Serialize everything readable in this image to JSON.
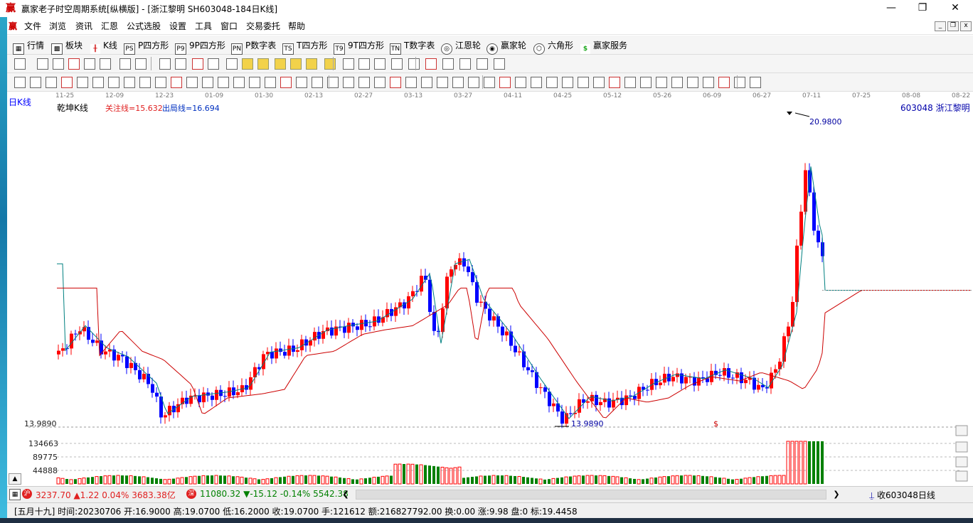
{
  "window": {
    "title": "赢家老子时空周期系统[纵横版] - [浙江黎明  SH603048-184日K线]",
    "logo_char": "赢",
    "minimize": "—",
    "restore": "❐",
    "close": "✕"
  },
  "menu": [
    "文件",
    "浏览",
    "资讯",
    "汇恩",
    "公式选股",
    "设置",
    "工具",
    "窗口",
    "交易委托",
    "帮助"
  ],
  "menu_logo": "赢",
  "toolbar1": [
    {
      "label": "行情",
      "icon": "grid-icon",
      "glyph": "▦"
    },
    {
      "label": "板块",
      "icon": "blocks-icon",
      "glyph": "▩"
    },
    {
      "label": "K线",
      "icon": "kline-icon",
      "glyph": "╫"
    },
    {
      "label": "P四方形",
      "icon": "p-square-icon",
      "glyph": "PS"
    },
    {
      "label": "9P四方形",
      "icon": "9p-square-icon",
      "glyph": "P9"
    },
    {
      "label": "P数字表",
      "icon": "p-table-icon",
      "glyph": "PN"
    },
    {
      "label": "T四方形",
      "icon": "t-square-icon",
      "glyph": "TS"
    },
    {
      "label": "9T四方形",
      "icon": "9t-square-icon",
      "glyph": "T9"
    },
    {
      "label": "T数字表",
      "icon": "t-table-icon",
      "glyph": "TN"
    },
    {
      "label": "江恩轮",
      "icon": "gann-wheel-icon",
      "glyph": "◎"
    },
    {
      "label": "赢家轮",
      "icon": "winner-wheel-icon",
      "glyph": "◉"
    },
    {
      "label": "六角形",
      "icon": "hexagon-icon",
      "glyph": "⬡"
    },
    {
      "label": "赢家服务",
      "icon": "dollar-icon",
      "glyph": "$"
    }
  ],
  "chart": {
    "period_label": "日K线",
    "indicator_name": "乾坤K线",
    "watch_line": "关注线=15.632",
    "exit_line": "出局线=16.694",
    "stock_label": "603048  浙江黎明",
    "high_label": "20.9800",
    "low_label": "13.9890",
    "low_axis_label": "13.9890",
    "dollar_mark": "$",
    "dates": [
      "11-25",
      "12-09",
      "12-23",
      "01-09",
      "01-30",
      "02-13",
      "02-27",
      "03-13",
      "03-27",
      "04-11",
      "04-25",
      "05-12",
      "05-26",
      "06-09",
      "06-27",
      "07-11",
      "07-25",
      "08-08",
      "08-22"
    ],
    "volume_axis": [
      "134663",
      "89775",
      "44888"
    ],
    "colors": {
      "up": "#ff0000",
      "down": "#0000ff",
      "transition": "#800080",
      "ma_short": "#008080",
      "ma_long": "#cc0000",
      "vol_up": "#ff0000",
      "vol_down": "#008000"
    }
  },
  "chart_data": {
    "type": "candlestick",
    "ylim": [
      13.989,
      20.98
    ],
    "high": 20.98,
    "low": 13.989
  },
  "taskbar": {
    "sh_index": "3237.70",
    "sh_change": "▲1.22",
    "sh_pct": "0.04%",
    "sh_amount": "3683.38亿",
    "sz_index": "11080.32",
    "sz_change": "▼-15.12",
    "sz_pct": "-0.14%",
    "sz_amount": "5542.38",
    "right_label": "收603048日线"
  },
  "status": {
    "text": "[五月十九] 时间:20230706 开:16.9000 高:19.0700 低:16.2000 收:19.0700 手:121612 额:216827792.00 换:0.00 涨:9.98 盘:0 标:19.4458"
  }
}
